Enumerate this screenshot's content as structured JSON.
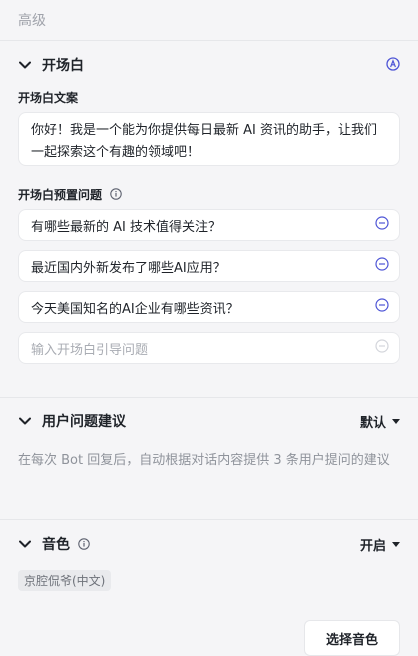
{
  "advanced": {
    "label": "高级"
  },
  "opening": {
    "title": "开场白",
    "text_label": "开场白文案",
    "text_value": "你好！我是一个能为你提供每日最新 AI 资讯的助手，让我们一起探索这个有趣的领域吧！",
    "preset_label": "开场白预置问题",
    "questions": [
      "有哪些最新的 AI 技术值得关注？",
      "最近国内外新发布了哪些AI应用？",
      "今天美国知名的AI企业有哪些资讯？"
    ],
    "input_placeholder": "输入开场白引导问题"
  },
  "suggestions": {
    "title": "用户问题建议",
    "mode": "默认",
    "description": "在每次 Bot 回复后，自动根据对话内容提供 3 条用户提问的建议"
  },
  "voice": {
    "title": "音色",
    "status": "开启",
    "selected_voice": "京腔侃爷(中文)",
    "select_button": "选择音色"
  },
  "colors": {
    "accent": "#4e55d6",
    "icon_gray": "#5e6270"
  },
  "icons": [
    "chevron-down-icon",
    "auto-icon",
    "info-icon",
    "remove-icon",
    "caret-down-icon"
  ]
}
